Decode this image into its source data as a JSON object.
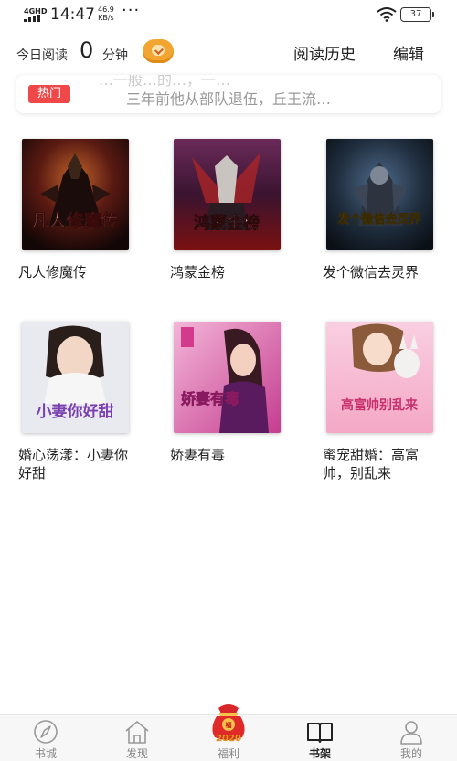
{
  "status_bar": {
    "network": "4GHD",
    "time": "14:47",
    "speed_value": "46.9",
    "speed_unit": "KB/s",
    "dots": "···",
    "battery": "37"
  },
  "header": {
    "today_label": "今日阅读",
    "today_count": "0",
    "today_unit": "分钟",
    "history_label": "阅读历史",
    "edit_label": "编辑"
  },
  "notice": {
    "badge": "热门",
    "prev_text": "…一般…的…，一…",
    "text": "三年前他从部队退伍，丘王流…"
  },
  "books": [
    {
      "title": "凡人修魔传",
      "cover_text": "凡人修魔传"
    },
    {
      "title": "鸿蒙金榜",
      "cover_text": "鸿蒙金榜"
    },
    {
      "title": "发个微信去灵界",
      "cover_text": "发个微信去灵界"
    },
    {
      "title": "婚心荡漾：小妻你好甜",
      "cover_text": "小妻你好甜"
    },
    {
      "title": "娇妻有毒",
      "cover_text": "娇妻有毒"
    },
    {
      "title": "蜜宠甜婚：高富帅，别乱来",
      "cover_text": "高富帅别乱来"
    }
  ],
  "tabs": [
    {
      "label": "书城",
      "icon": "compass-icon"
    },
    {
      "label": "发现",
      "icon": "home-icon"
    },
    {
      "label": "福利",
      "icon": "lucky-bag-icon",
      "badge_year": "2020"
    },
    {
      "label": "书架",
      "icon": "open-book-icon",
      "active": true
    },
    {
      "label": "我的",
      "icon": "person-icon"
    }
  ],
  "colors": {
    "hot_badge": "#f04848",
    "coin": "#f2a531",
    "tab_inactive": "#888888",
    "tab_active": "#222222"
  }
}
